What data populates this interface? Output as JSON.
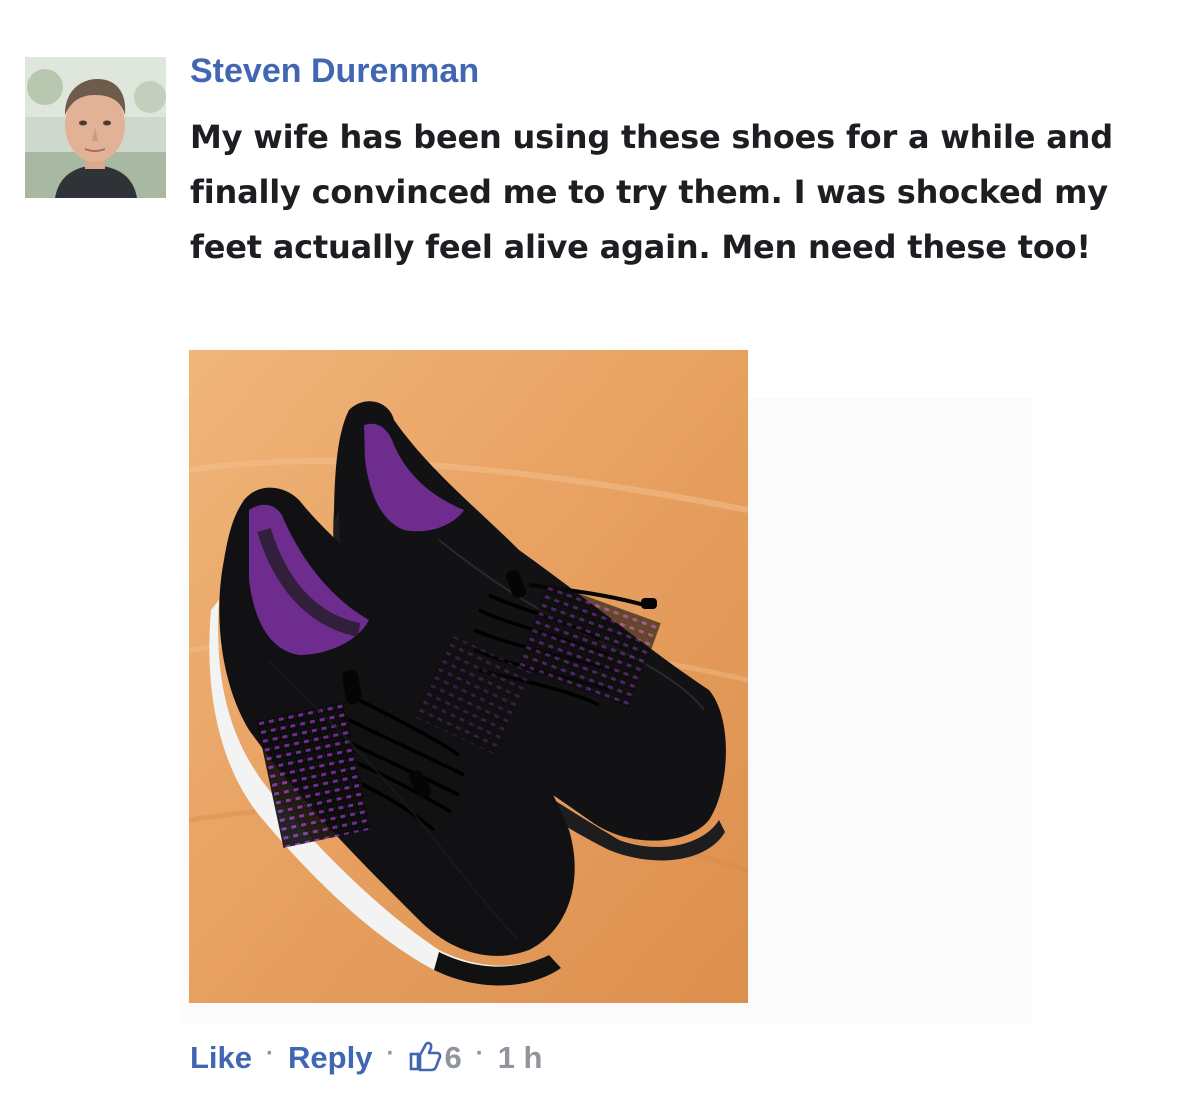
{
  "comment": {
    "author": "Steven Durenman",
    "text": "My wife has been using these shoes for a while and finally convinced me to try them. I was shocked my feet actually feel alive again. Men need these too!",
    "avatar_icon": "user-avatar",
    "photo_description_icon": "shoe-photo",
    "actions": {
      "like_label": "Like",
      "separator": "·",
      "reply_label": "Reply",
      "like_icon": "thumbs-up-icon",
      "like_count": "6",
      "timestamp": "1 h"
    }
  },
  "colors": {
    "link": "#4267b2",
    "meta": "#90949c",
    "text": "#1c1e21"
  }
}
